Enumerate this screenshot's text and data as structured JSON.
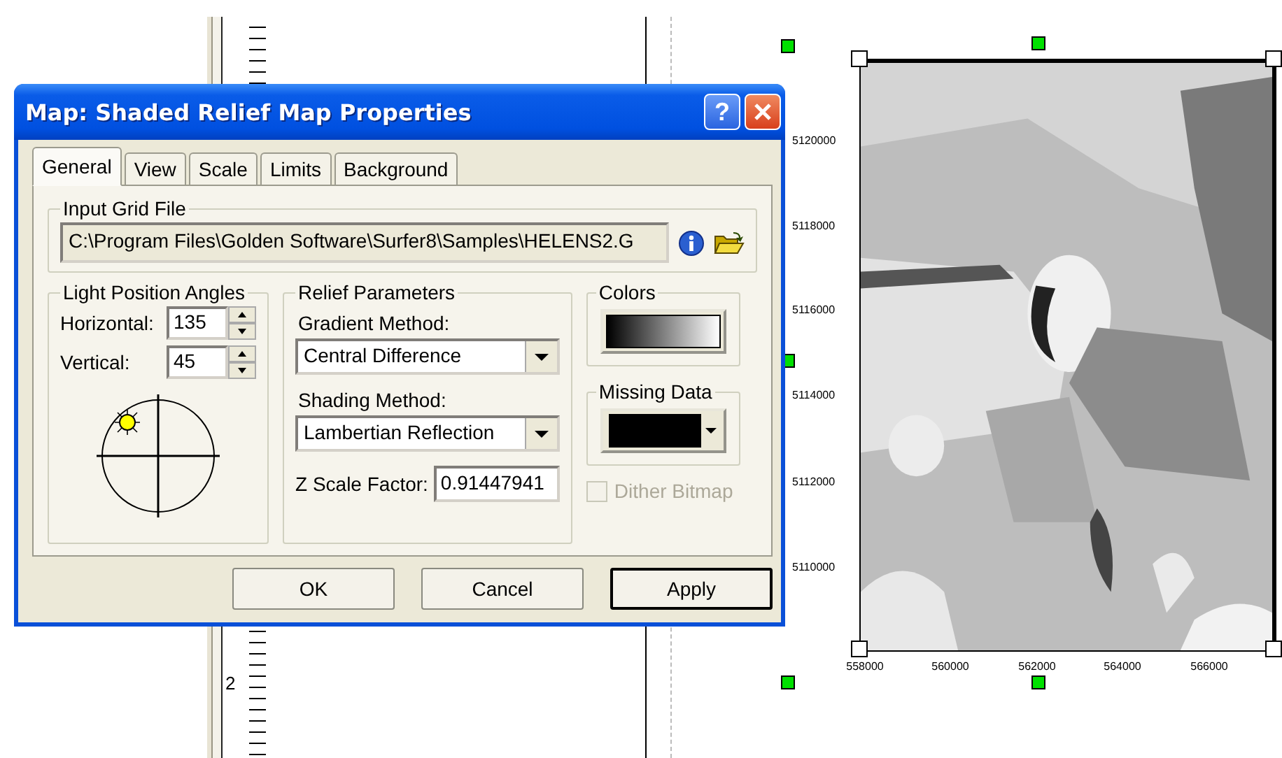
{
  "ruler": {
    "label": "2"
  },
  "dialog": {
    "title": "Map: Shaded Relief Map Properties",
    "help_button": "?",
    "tabs": [
      {
        "label": "General",
        "selected": true
      },
      {
        "label": "View",
        "selected": false
      },
      {
        "label": "Scale",
        "selected": false
      },
      {
        "label": "Limits",
        "selected": false
      },
      {
        "label": "Background",
        "selected": false
      }
    ],
    "input_grid_file": {
      "label": "Input Grid File",
      "value": "C:\\Program Files\\Golden Software\\Surfer8\\Samples\\HELENS2.G"
    },
    "light_position": {
      "label": "Light Position Angles",
      "horizontal": {
        "label": "Horizontal:",
        "value": "135"
      },
      "vertical": {
        "label": "Vertical:",
        "value": "45"
      }
    },
    "relief": {
      "label": "Relief Parameters",
      "gradient": {
        "label": "Gradient Method:",
        "value": "Central Difference"
      },
      "shading": {
        "label": "Shading Method:",
        "value": "Lambertian Reflection"
      },
      "z_scale": {
        "label": "Z Scale Factor:",
        "value": "0.91447941"
      }
    },
    "colors": {
      "label": "Colors"
    },
    "missing_data": {
      "label": "Missing Data"
    },
    "dither": {
      "label": "Dither Bitmap",
      "checked": false,
      "disabled": true
    },
    "buttons": [
      {
        "label": "OK",
        "default": false
      },
      {
        "label": "Cancel",
        "default": false
      },
      {
        "label": "Apply",
        "default": true
      }
    ]
  },
  "map": {
    "y_labels": [
      "5120000",
      "5118000",
      "5116000",
      "5114000",
      "5112000",
      "5110000"
    ],
    "x_labels": [
      "558000",
      "560000",
      "562000",
      "564000",
      "566000"
    ]
  }
}
